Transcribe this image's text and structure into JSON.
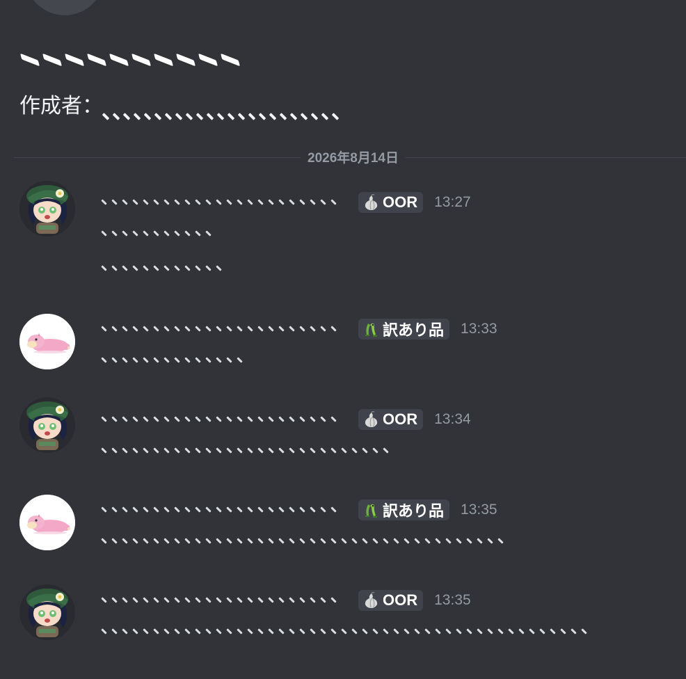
{
  "channel": {
    "name_glyph_count": 10,
    "creator_label": "作成者：",
    "creator_tick_count": 23
  },
  "date_divider": "2026年8月14日",
  "badges": {
    "oor": {
      "label": "OOR",
      "icon": "onion-icon"
    },
    "wakeari": {
      "label": "訳あり品",
      "icon": "gecko-icon"
    }
  },
  "messages": [
    {
      "author_avatar": "venti-avatar",
      "badge": "OOR",
      "time": "13:27",
      "name_ticks": 23,
      "lines": [
        11,
        12
      ]
    },
    {
      "author_avatar": "slowpoke-avatar",
      "badge": "訳あり品",
      "time": "13:33",
      "name_ticks": 23,
      "lines": [
        14
      ]
    },
    {
      "author_avatar": "venti-avatar",
      "badge": "OOR",
      "time": "13:34",
      "name_ticks": 23,
      "lines": [
        28
      ]
    },
    {
      "author_avatar": "slowpoke-avatar",
      "badge": "訳あり品",
      "time": "13:35",
      "name_ticks": 23,
      "lines": [
        39
      ]
    },
    {
      "author_avatar": "venti-avatar",
      "badge": "OOR",
      "time": "13:35",
      "name_ticks": 23,
      "lines": [
        47
      ]
    }
  ],
  "colors": {
    "background": "#313338",
    "badge_bg": "#40434b",
    "timestamp": "#949ba4",
    "text": "#dbdee1"
  }
}
